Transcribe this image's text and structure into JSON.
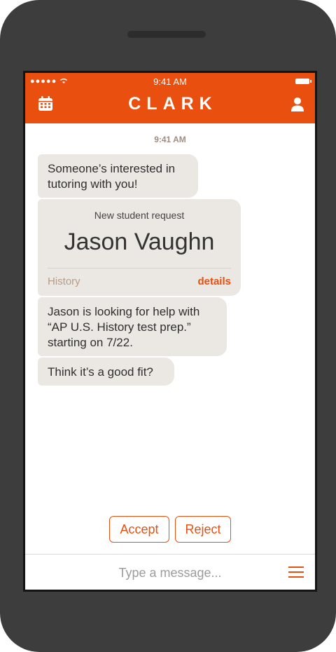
{
  "status_bar": {
    "signal": "●●●●● ",
    "time": "9:41 AM"
  },
  "app_bar": {
    "title": "CLARK",
    "left_icon": "calendar-icon",
    "right_icon": "user-icon",
    "color": "#e94f0e"
  },
  "chat": {
    "timestamp": "9:41 AM",
    "messages": [
      {
        "line1": "Someone’s interested in",
        "line2": "tutoring with you!"
      },
      {
        "line1": "Jason is looking for help with",
        "line2": "“AP U.S. History test prep.”",
        "line3": "starting on 7/22."
      },
      {
        "line1": "Think it’s a good fit?"
      }
    ],
    "request_card": {
      "title": "New student request",
      "name": "Jason Vaughn",
      "subject": "History",
      "details_label": "details"
    }
  },
  "actions": {
    "accept_label": "Accept",
    "reject_label": "Reject"
  },
  "composer": {
    "placeholder": "Type a message...",
    "menu_icon": "hamburger-menu-icon"
  }
}
